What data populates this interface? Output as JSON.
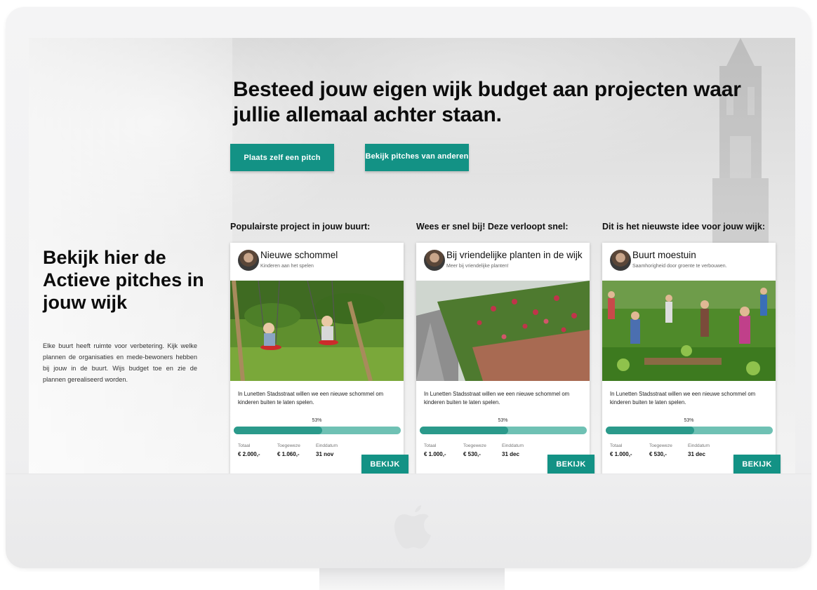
{
  "hero": {
    "title": "Besteed jouw eigen wijk budget aan projecten waar jullie allemaal achter staan.",
    "btn_pitch": "Plaats zelf een pitch",
    "btn_others": "Bekijk pitches van anderen"
  },
  "sidebar": {
    "title": "Bekijk hier de Actieve pitches in jouw wijk",
    "text": "Elke buurt heeft ruimte voor verbetering. Kijk welke plannen de organisaties en mede-bewoners hebben bij jouw in de buurt. Wijs budget toe en zie de plannen gerealiseerd worden."
  },
  "colors": {
    "accent": "#139285",
    "progress_track": "#6fc1b4",
    "progress_fill": "#2b9a8b"
  },
  "cards": [
    {
      "heading": "Populairste project in jouw buurt:",
      "title": "Nieuwe schommel",
      "subtitle": "Kinderen aan het spelen",
      "description": "In Lunetten Stadsstraat willen we een nieuwe schommel om kinderen buiten te laten spelen.",
      "percent_label": "53%",
      "progress": 0.53,
      "stats": {
        "total_label": "Totaal",
        "total_value": "€ 2.000,-",
        "granted_label": "Toegeweze",
        "granted_value": "€ 1.060,-",
        "end_label": "Einddatum",
        "end_value": "31 nov"
      },
      "button": "BEKIJK",
      "image_icon": "swing-photo"
    },
    {
      "heading": "Wees er snel bij! Deze verloopt snel:",
      "title": "Bij vriendelijke planten in de wijk",
      "subtitle": "Meer bij vriendelijke planten!",
      "description": "In Lunetten Stadsstraat willen we een nieuwe schommel om kinderen buiten te laten spelen.",
      "percent_label": "53%",
      "progress": 0.53,
      "stats": {
        "total_label": "Totaal",
        "total_value": "€ 1.000,-",
        "granted_label": "Toegeweze",
        "granted_value": "€ 530,-",
        "end_label": "Einddatum",
        "end_value": "31 dec"
      },
      "button": "BEKIJK",
      "image_icon": "flower-wall-photo"
    },
    {
      "heading": "Dit is het nieuwste idee voor jouw wijk:",
      "title": "Buurt moestuin",
      "subtitle": "Saamhorigheid door groente te verbouwen.",
      "description": "In Lunetten Stadsstraat willen we een nieuwe schommel om kinderen buiten te laten spelen.",
      "percent_label": "53%",
      "progress": 0.53,
      "stats": {
        "total_label": "Totaal",
        "total_value": "€ 1.000,-",
        "granted_label": "Toegeweze",
        "granted_value": "€ 530,-",
        "end_label": "Einddatum",
        "end_value": "31 dec"
      },
      "button": "BEKIJK",
      "image_icon": "garden-photo"
    }
  ]
}
